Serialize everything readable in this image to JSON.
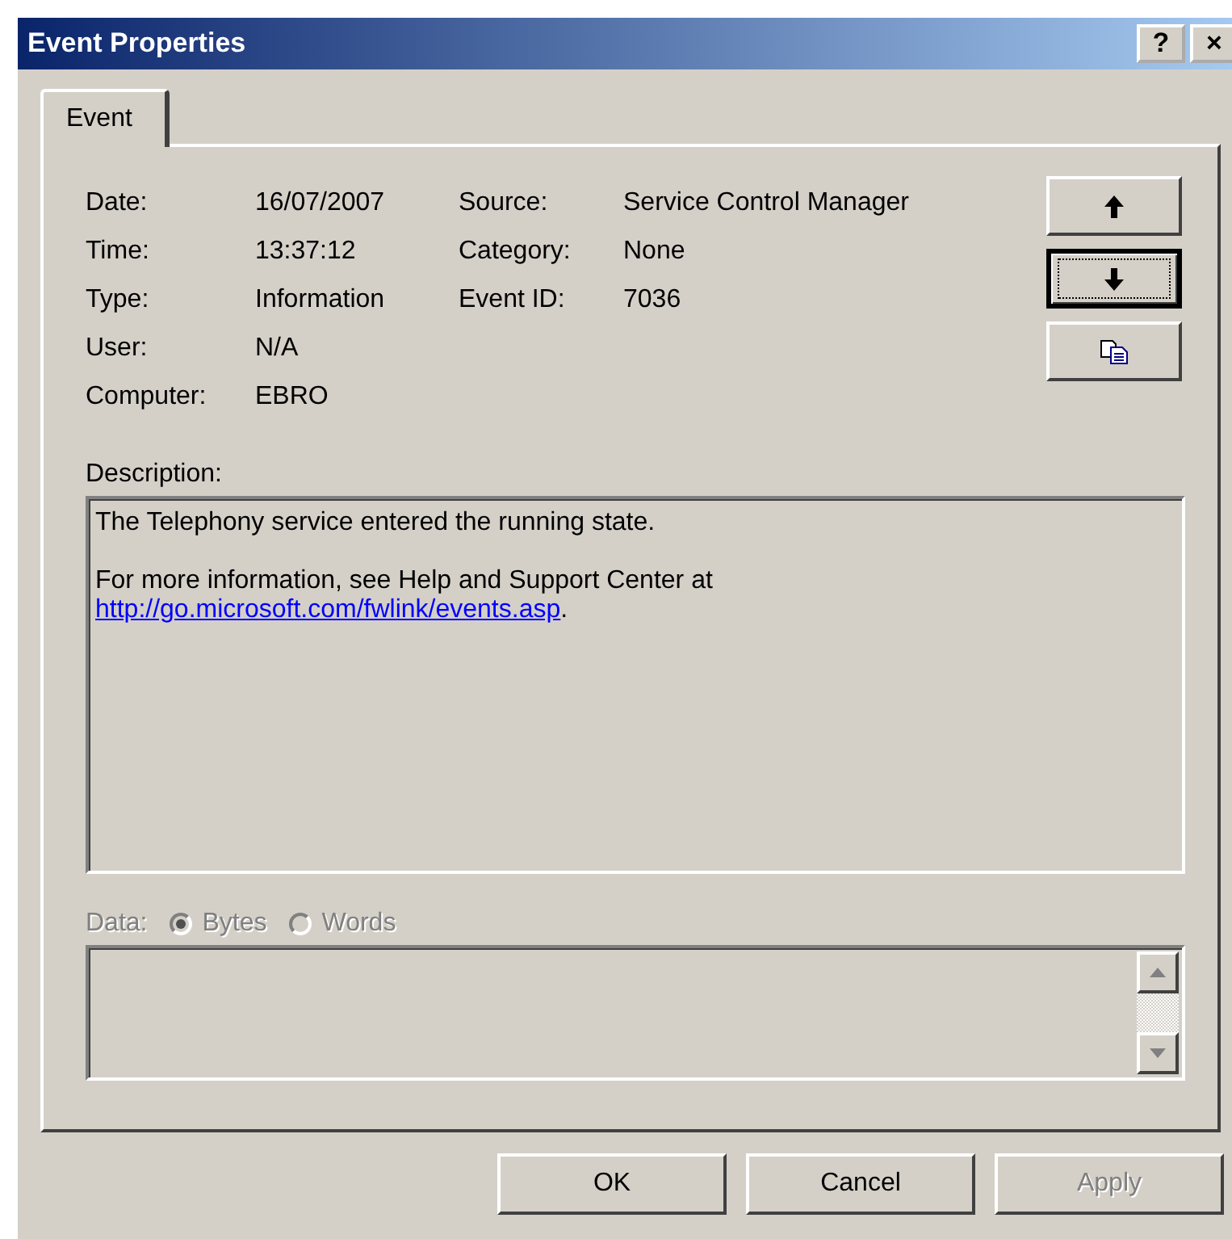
{
  "window": {
    "title": "Event Properties",
    "title_buttons": [
      "?",
      "×"
    ]
  },
  "tabs": [
    {
      "label": "Event",
      "selected": true
    }
  ],
  "left_fields": [
    {
      "label": "Date:",
      "value": "16/07/2007"
    },
    {
      "label": "Time:",
      "value": "13:37:12"
    },
    {
      "label": "Type:",
      "value": "Information"
    },
    {
      "label": "User:",
      "value": "N/A"
    },
    {
      "label": "Computer:",
      "value": "EBRO"
    }
  ],
  "right_fields": [
    {
      "label": "Source:",
      "value": "Service Control Manager"
    },
    {
      "label": "Category:",
      "value": "None"
    },
    {
      "label": "Event ID:",
      "value": "7036"
    }
  ],
  "nav_buttons": [
    {
      "kind": "up",
      "focused": false
    },
    {
      "kind": "down",
      "focused": true
    },
    {
      "kind": "copy",
      "focused": false
    }
  ],
  "description": {
    "label": "Description:",
    "paragraphs": [
      {
        "text": "The Telephony service entered the running state."
      },
      {
        "text": "For more information, see Help and Support Center at",
        "link": "http://go.microsoft.com/fwlink/events.asp",
        "after": "."
      }
    ]
  },
  "data": {
    "label": "Data:",
    "disabled": true,
    "options": [
      {
        "label": "Bytes",
        "selected": true
      },
      {
        "label": "Words",
        "selected": false
      }
    ]
  },
  "buttons": [
    {
      "label": "OK",
      "disabled": false
    },
    {
      "label": "Cancel",
      "disabled": false
    },
    {
      "label": "Apply",
      "disabled": true
    }
  ]
}
